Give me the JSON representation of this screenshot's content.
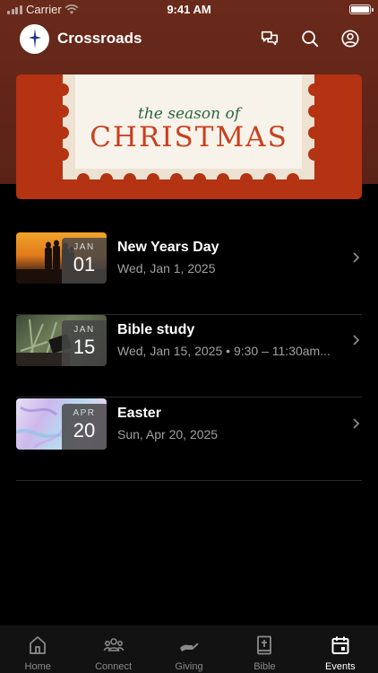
{
  "status_bar": {
    "carrier": "Carrier",
    "time": "9:41 AM"
  },
  "header": {
    "title": "Crossroads",
    "icons": [
      "logo-cross-icon",
      "chat-icon",
      "search-icon",
      "profile-icon"
    ]
  },
  "banner": {
    "line1": "the season of",
    "line2": "CHRISTMAS"
  },
  "events": [
    {
      "title": "New Years Day",
      "subtitle": "Wed, Jan 1, 2025",
      "month": "JAN",
      "day": "01"
    },
    {
      "title": "Bible study",
      "subtitle": "Wed, Jan 15, 2025 • 9:30 – 11:30am...",
      "month": "JAN",
      "day": "15"
    },
    {
      "title": "Easter",
      "subtitle": "Sun, Apr 20, 2025",
      "month": "APR",
      "day": "20"
    }
  ],
  "tabs": [
    {
      "label": "Home",
      "icon": "home-icon"
    },
    {
      "label": "Connect",
      "icon": "people-icon"
    },
    {
      "label": "Giving",
      "icon": "giving-hand-icon"
    },
    {
      "label": "Bible",
      "icon": "bible-icon"
    },
    {
      "label": "Events",
      "icon": "calendar-icon",
      "active": true
    }
  ],
  "colors": {
    "header_bg": "#6a2a1b",
    "banner_bg": "#b33312",
    "accent_green": "#2c6545",
    "accent_red": "#c9401f"
  }
}
